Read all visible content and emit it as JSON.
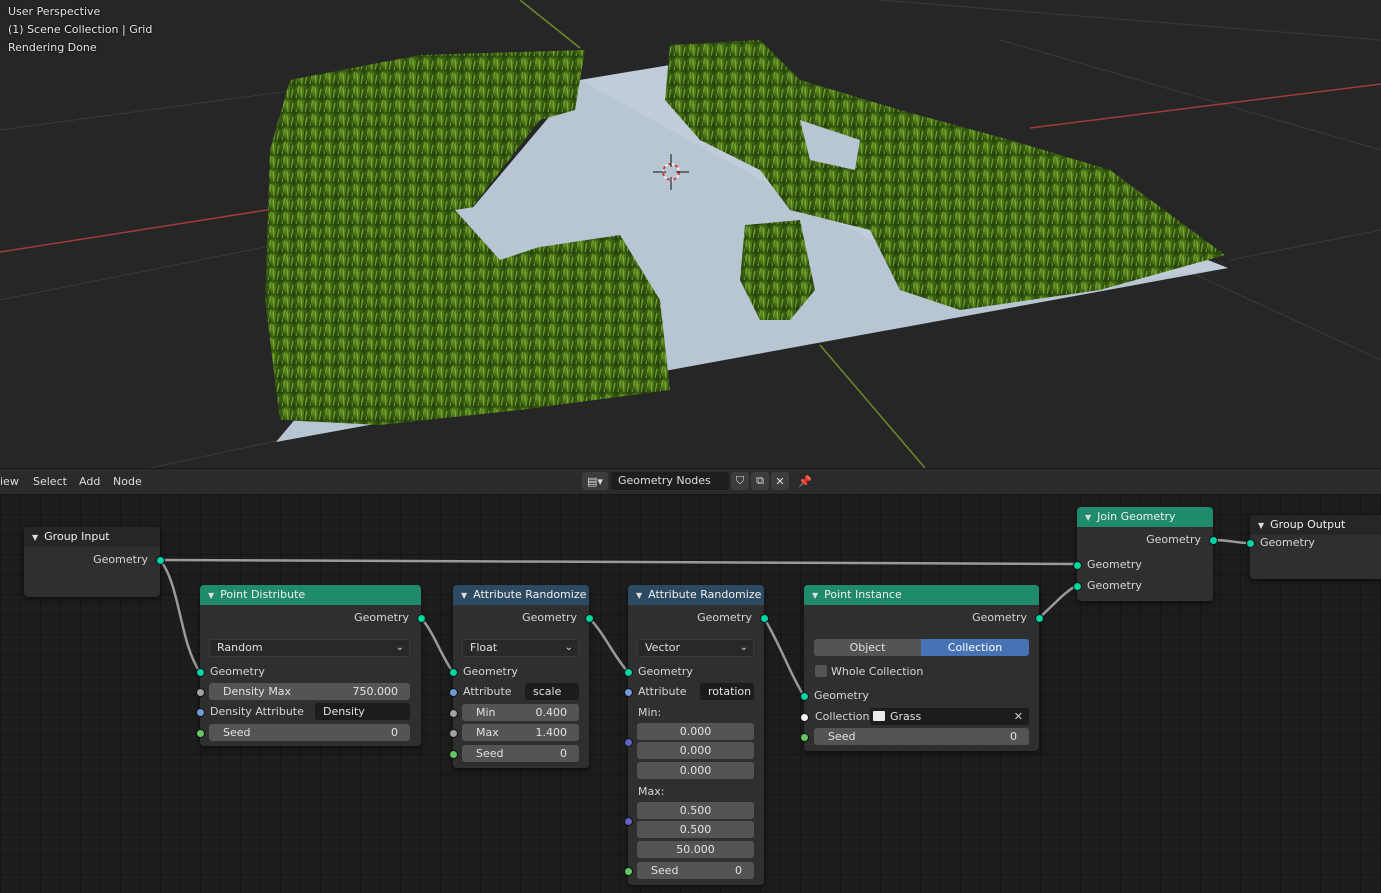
{
  "viewport": {
    "overlay": [
      "User Perspective",
      "(1) Scene Collection | Grid",
      "Rendering Done"
    ]
  },
  "header": {
    "menu": [
      "iew",
      "Select",
      "Add",
      "Node"
    ],
    "node_tree_name": "Geometry Nodes",
    "icons": [
      "node-tree-browse-icon",
      "fake-user-shield-icon",
      "duplicate-icon",
      "close-icon",
      "pin-icon"
    ]
  },
  "colors": {
    "geometry_socket": "#00d6a3",
    "float_socket": "#a1a1a1",
    "string_socket": "#6f9bd6",
    "int_socket": "#63c763",
    "vector_socket": "#6363c7",
    "geometry_node_header": "#1f8a6c",
    "attribute_node_header": "#2d4a63",
    "active_toggle": "#4772b3"
  },
  "nodes": {
    "group_input": {
      "title": "Group Input",
      "out_geometry": "Geometry"
    },
    "point_distribute": {
      "title": "Point Distribute",
      "out_geometry": "Geometry",
      "mode": "Random",
      "in_geometry": "Geometry",
      "density_max_label": "Density Max",
      "density_max_value": "750.000",
      "density_attr_label": "Density Attribute",
      "density_attr_value": "Density",
      "seed_label": "Seed",
      "seed_value": "0"
    },
    "attr_randomize_1": {
      "title": "Attribute Randomize",
      "out_geometry": "Geometry",
      "type": "Float",
      "in_geometry": "Geometry",
      "attribute_label": "Attribute",
      "attribute_value": "scale",
      "min_label": "Min",
      "min_value": "0.400",
      "max_label": "Max",
      "max_value": "1.400",
      "seed_label": "Seed",
      "seed_value": "0"
    },
    "attr_randomize_2": {
      "title": "Attribute Randomize",
      "out_geometry": "Geometry",
      "type": "Vector",
      "in_geometry": "Geometry",
      "attribute_label": "Attribute",
      "attribute_value": "rotation",
      "min_label": "Min:",
      "min_values": [
        "0.000",
        "0.000",
        "0.000"
      ],
      "max_label": "Max:",
      "max_values": [
        "0.500",
        "0.500",
        "50.000"
      ],
      "seed_label": "Seed",
      "seed_value": "0"
    },
    "point_instance": {
      "title": "Point Instance",
      "out_geometry": "Geometry",
      "toggle_object": "Object",
      "toggle_collection": "Collection",
      "active": "Collection",
      "whole_collection_label": "Whole Collection",
      "whole_collection_checked": false,
      "in_geometry": "Geometry",
      "collection_label": "Collection:",
      "collection_value": "Grass",
      "seed_label": "Seed",
      "seed_value": "0"
    },
    "join_geometry": {
      "title": "Join Geometry",
      "out_geometry": "Geometry",
      "in_geometry_1": "Geometry",
      "in_geometry_2": "Geometry"
    },
    "group_output": {
      "title": "Group Output",
      "in_geometry": "Geometry"
    }
  }
}
